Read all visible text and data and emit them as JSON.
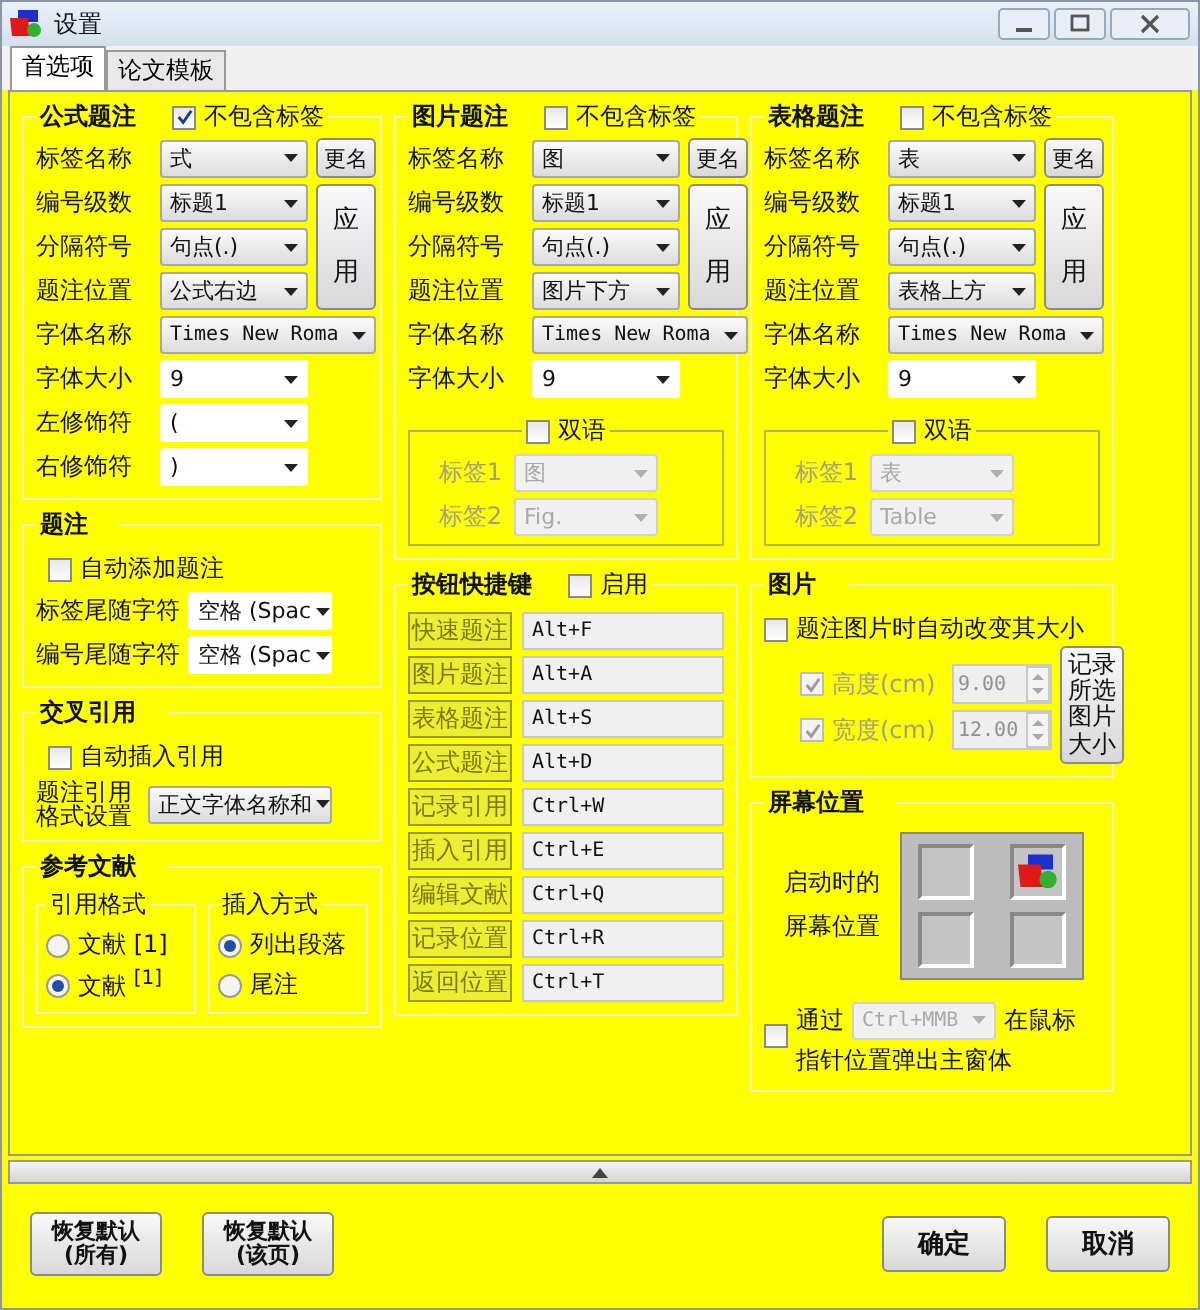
{
  "window": {
    "title": "设置"
  },
  "tabs": [
    {
      "label": "首选项",
      "selected": true
    },
    {
      "label": "论文模板",
      "selected": false
    }
  ],
  "caption_groups": [
    {
      "title": "公式题注",
      "exclude_label": {
        "label": "不包含标签",
        "checked": true
      },
      "rename_button": "更名",
      "apply_button": "应用",
      "rows": [
        {
          "label": "标签名称",
          "value": "式",
          "kind": "select"
        },
        {
          "label": "编号级数",
          "value": "标题1",
          "kind": "select"
        },
        {
          "label": "分隔符号",
          "value": "句点(.)",
          "kind": "select"
        },
        {
          "label": "题注位置",
          "value": "公式右边",
          "kind": "select"
        },
        {
          "label": "字体名称",
          "value": "Times New Roma",
          "kind": "wide"
        },
        {
          "label": "字体大小",
          "value": "9",
          "kind": "combo"
        },
        {
          "label": "左修饰符",
          "value": "(",
          "kind": "combo"
        },
        {
          "label": "右修饰符",
          "value": ")",
          "kind": "combo"
        }
      ]
    },
    {
      "title": "图片题注",
      "exclude_label": {
        "label": "不包含标签",
        "checked": false
      },
      "rename_button": "更名",
      "apply_button": "应用",
      "rows": [
        {
          "label": "标签名称",
          "value": "图",
          "kind": "select"
        },
        {
          "label": "编号级数",
          "value": "标题1",
          "kind": "select"
        },
        {
          "label": "分隔符号",
          "value": "句点(.)",
          "kind": "select"
        },
        {
          "label": "题注位置",
          "value": "图片下方",
          "kind": "select"
        },
        {
          "label": "字体名称",
          "value": "Times New Roma",
          "kind": "wide"
        },
        {
          "label": "字体大小",
          "value": "9",
          "kind": "combo"
        }
      ],
      "bilingual": {
        "label": "双语",
        "checked": false,
        "rows": [
          {
            "label": "标签1",
            "value": "图"
          },
          {
            "label": "标签2",
            "value": "Fig."
          }
        ]
      }
    },
    {
      "title": "表格题注",
      "exclude_label": {
        "label": "不包含标签",
        "checked": false
      },
      "rename_button": "更名",
      "apply_button": "应用",
      "rows": [
        {
          "label": "标签名称",
          "value": "表",
          "kind": "select"
        },
        {
          "label": "编号级数",
          "value": "标题1",
          "kind": "select"
        },
        {
          "label": "分隔符号",
          "value": "句点(.)",
          "kind": "select"
        },
        {
          "label": "题注位置",
          "value": "表格上方",
          "kind": "select"
        },
        {
          "label": "字体名称",
          "value": "Times New Roma",
          "kind": "wide"
        },
        {
          "label": "字体大小",
          "value": "9",
          "kind": "combo"
        }
      ],
      "bilingual": {
        "label": "双语",
        "checked": false,
        "rows": [
          {
            "label": "标签1",
            "value": "表"
          },
          {
            "label": "标签2",
            "value": "Table"
          }
        ]
      }
    }
  ],
  "caption": {
    "title": "题注",
    "auto_add": {
      "label": "自动添加题注",
      "checked": false
    },
    "rows": [
      {
        "label": "标签尾随字符",
        "value": "空格 (Spac"
      },
      {
        "label": "编号尾随字符",
        "value": "空格 (Spac"
      }
    ]
  },
  "cross_reference": {
    "title": "交叉引用",
    "auto_insert": {
      "label": "自动插入引用",
      "checked": false
    },
    "format": {
      "label_lines": [
        "题注引用",
        "格式设置"
      ],
      "value": "正文字体名称和"
    }
  },
  "references": {
    "title": "参考文献",
    "groups": [
      {
        "title": "引用格式",
        "options": [
          {
            "label": "文献 [1]",
            "selected": false
          },
          {
            "label": "文献 $^{[1]}$",
            "selected": true
          }
        ]
      },
      {
        "title": "插入方式",
        "options": [
          {
            "label": "列出段落",
            "selected": true
          },
          {
            "label": "尾注",
            "selected": false
          }
        ]
      }
    ]
  },
  "shortcuts": {
    "title": "按钮快捷键",
    "enable": {
      "label": "启用",
      "checked": false
    },
    "rows": [
      {
        "label": "快速题注",
        "value": "Alt+F"
      },
      {
        "label": "图片题注",
        "value": "Alt+A"
      },
      {
        "label": "表格题注",
        "value": "Alt+S"
      },
      {
        "label": "公式题注",
        "value": "Alt+D"
      },
      {
        "label": "记录引用",
        "value": "Ctrl+W"
      },
      {
        "label": "插入引用",
        "value": "Ctrl+E"
      },
      {
        "label": "编辑文献",
        "value": "Ctrl+Q"
      },
      {
        "label": "记录位置",
        "value": "Ctrl+R"
      },
      {
        "label": "返回位置",
        "value": "Ctrl+T"
      }
    ]
  },
  "picture": {
    "title": "图片",
    "auto_resize": {
      "label": "题注图片时自动改变其大小",
      "checked": false
    },
    "rows": [
      {
        "label": "高度(cm)",
        "value": "9.00",
        "checked": true
      },
      {
        "label": "宽度(cm)",
        "value": "12.00",
        "checked": true
      }
    ],
    "record_button": "记录所选图片大小"
  },
  "screen_position": {
    "title": "屏幕位置",
    "label_lines": [
      "启动时的",
      "屏幕位置"
    ],
    "cells": [
      {
        "selected": false
      },
      {
        "selected": true
      },
      {
        "selected": false
      },
      {
        "selected": false
      }
    ],
    "popup": {
      "checked": false,
      "prefix": "通过",
      "shortcut": "Ctrl+MMB",
      "suffix": "在鼠标",
      "second_line": "指针位置弹出主窗体"
    }
  },
  "footer": {
    "reset_buttons": [
      "恢复默认\n(所有)",
      "恢复默认\n(该页)"
    ],
    "buttons": [
      "确定",
      "取消"
    ]
  }
}
